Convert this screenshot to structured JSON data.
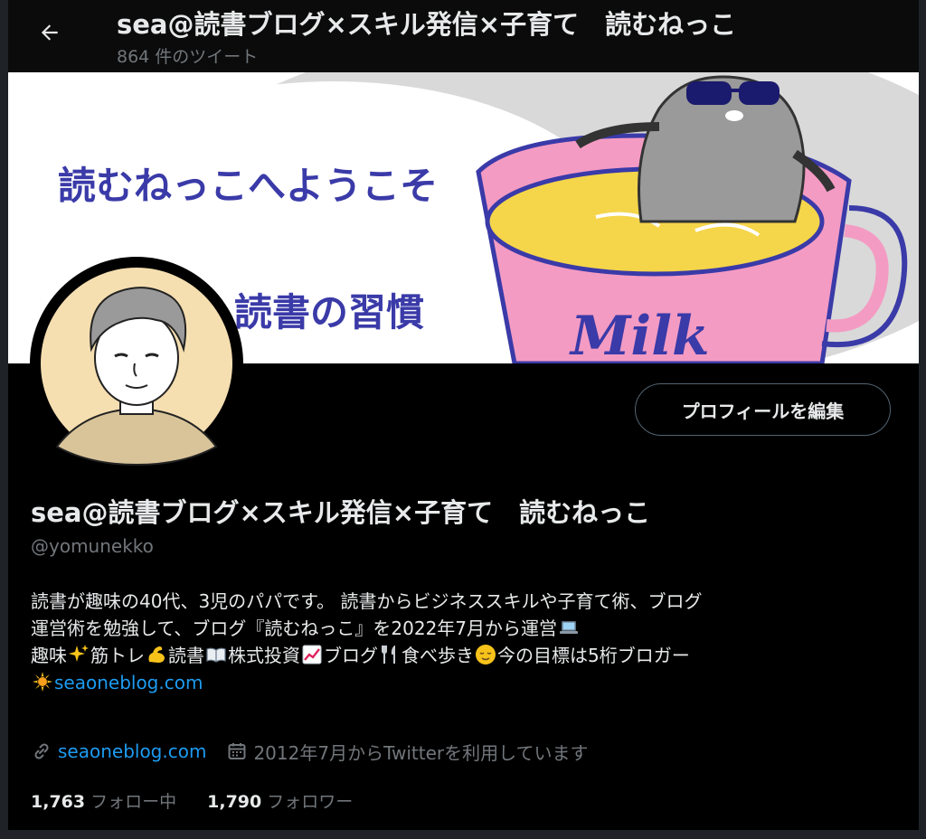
{
  "header": {
    "title": "sea@読書ブログ×スキル発信×子育て　読むねっこ",
    "tweet_count": "864 件のツイート"
  },
  "banner": {
    "welcome_text": "読むねっこへようこそ",
    "habit_text": "読書の習慣",
    "cup_text": "Milk"
  },
  "profile": {
    "edit_button": "プロフィールを編集",
    "display_name": "sea@読書ブログ×スキル発信×子育て　読むねっこ",
    "handle": "@yomunekko",
    "bio": {
      "line1": "読書が趣味の40代、3児のパパです。 読書からビジネススキルや子育て術、ブログ",
      "line2": "運営術を勉強して、ブログ『読むねっこ』を2022年7月から運営",
      "line3_a": "趣味",
      "line3_b": "筋トレ",
      "line3_c": "読書",
      "line3_d": "株式投資",
      "line3_e": "ブログ",
      "line3_f": "食べ歩き",
      "line3_g": "今の目標は5桁ブロガー",
      "link": "seaoneblog.com"
    },
    "website": "seaoneblog.com",
    "joined": "2012年7月からTwitterを利用しています",
    "following_count": "1,763",
    "following_label": "フォロー中",
    "followers_count": "1,790",
    "followers_label": "フォロワー"
  },
  "colors": {
    "background": "#000000",
    "link": "#1d9bf0",
    "muted": "#71767b",
    "banner_cup": "#f49bc3",
    "banner_text": "#3a3aa8"
  },
  "icons": [
    "back-arrow-icon",
    "link-icon",
    "calendar-icon",
    "laptop-emoji",
    "sparkles-emoji",
    "flexed-biceps-emoji",
    "open-book-emoji",
    "chart-up-emoji",
    "fork-knife-emoji",
    "relieved-face-emoji",
    "sun-emoji"
  ]
}
